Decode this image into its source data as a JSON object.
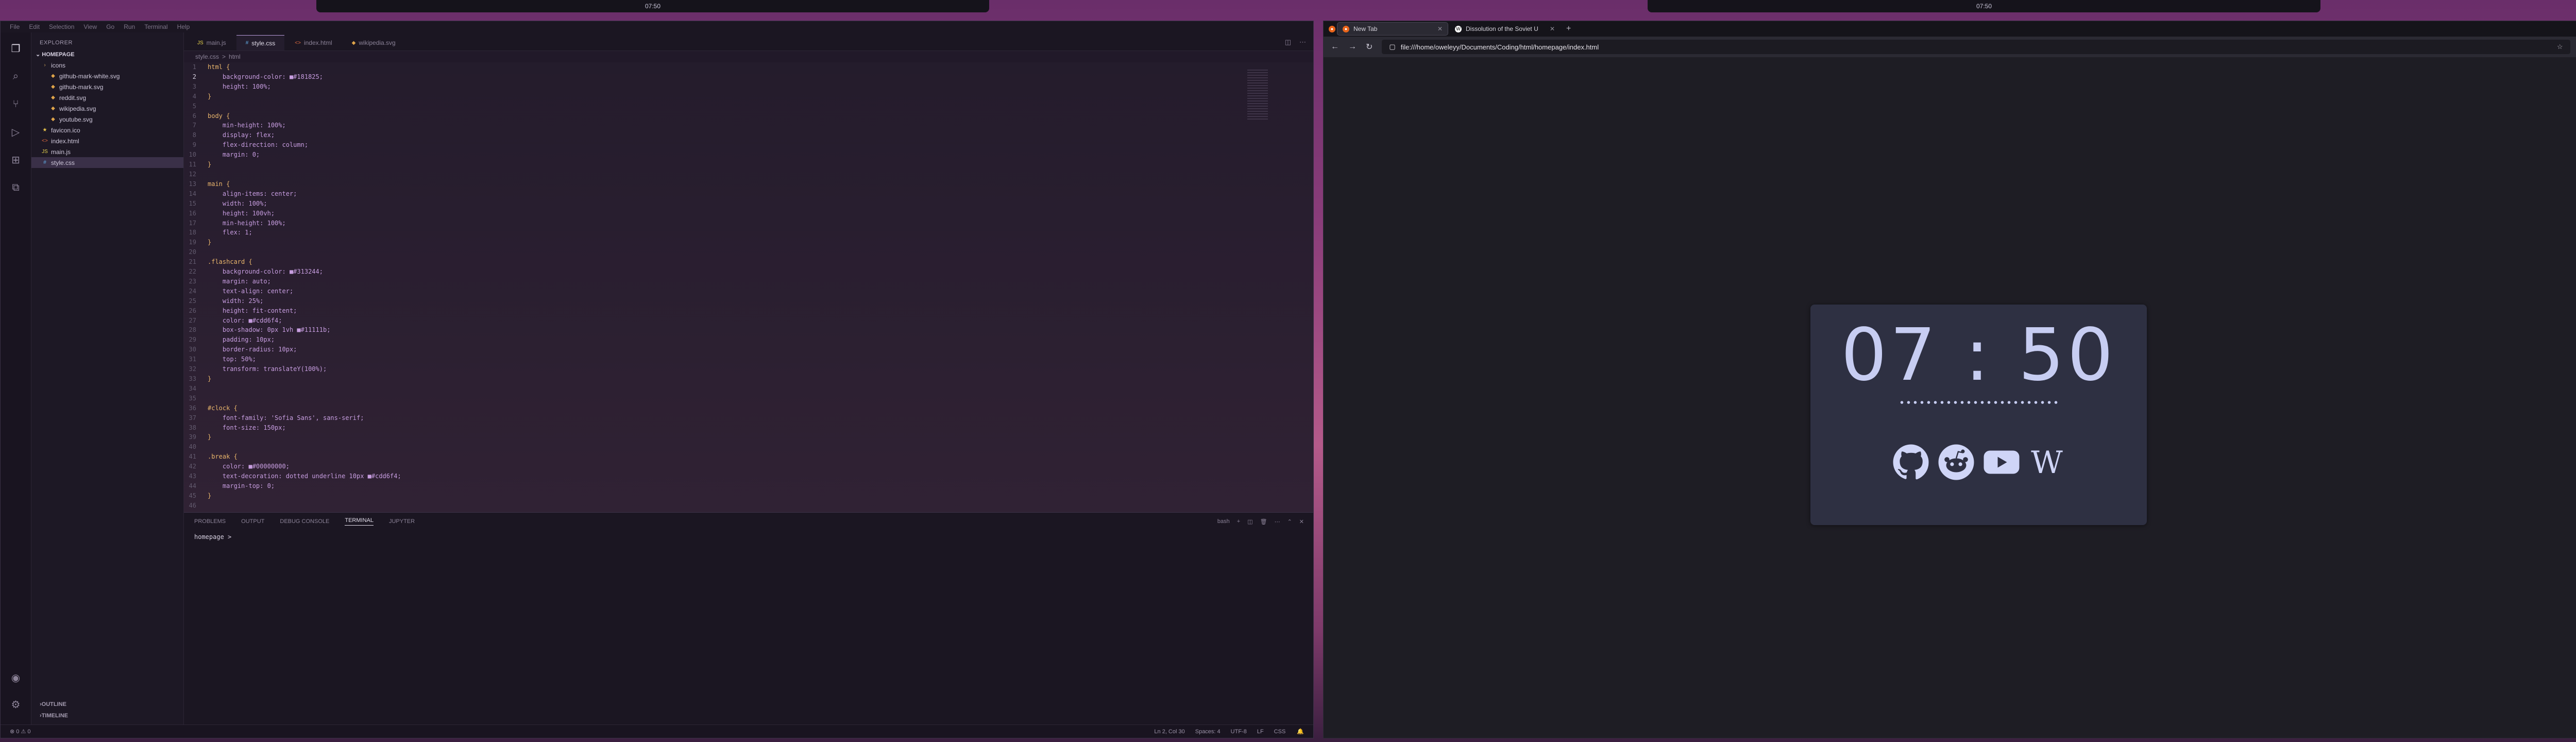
{
  "desktop": {
    "clock_left": "07:50",
    "clock_right": "07:50",
    "workspace_icon": "♾"
  },
  "vscode": {
    "menu": [
      "File",
      "Edit",
      "Selection",
      "View",
      "Go",
      "Run",
      "Terminal",
      "Help"
    ],
    "explorer_label": "EXPLORER",
    "folder": "HOMEPAGE",
    "tree": [
      {
        "name": "icons",
        "depth": 1,
        "kind": "folder"
      },
      {
        "name": "github-mark-white.svg",
        "depth": 2,
        "kind": "svg"
      },
      {
        "name": "github-mark.svg",
        "depth": 2,
        "kind": "svg"
      },
      {
        "name": "reddit.svg",
        "depth": 2,
        "kind": "svg"
      },
      {
        "name": "wikipedia.svg",
        "depth": 2,
        "kind": "svg"
      },
      {
        "name": "youtube.svg",
        "depth": 2,
        "kind": "svg"
      },
      {
        "name": "favicon.ico",
        "depth": 1,
        "kind": "ico"
      },
      {
        "name": "index.html",
        "depth": 1,
        "kind": "html"
      },
      {
        "name": "main.js",
        "depth": 1,
        "kind": "js"
      },
      {
        "name": "style.css",
        "depth": 1,
        "kind": "css",
        "selected": true
      }
    ],
    "outline": "OUTLINE",
    "timeline": "TIMELINE",
    "tabs": [
      {
        "label": "main.js",
        "active": false
      },
      {
        "label": "style.css",
        "active": true
      },
      {
        "label": "index.html",
        "active": false
      },
      {
        "label": "wikipedia.svg",
        "active": false
      }
    ],
    "breadcrumb": [
      "style.css",
      ">",
      "html"
    ],
    "code": [
      {
        "n": "1",
        "t": "html {"
      },
      {
        "n": "2",
        "t": "    background-color: ■#181825;"
      },
      {
        "n": "3",
        "t": "    height: 100%;"
      },
      {
        "n": "4",
        "t": "}"
      },
      {
        "n": "5",
        "t": ""
      },
      {
        "n": "6",
        "t": "body {"
      },
      {
        "n": "7",
        "t": "    min-height: 100%;"
      },
      {
        "n": "8",
        "t": "    display: flex;"
      },
      {
        "n": "9",
        "t": "    flex-direction: column;"
      },
      {
        "n": "10",
        "t": "    margin: 0;"
      },
      {
        "n": "11",
        "t": "}"
      },
      {
        "n": "12",
        "t": ""
      },
      {
        "n": "13",
        "t": "main {"
      },
      {
        "n": "14",
        "t": "    align-items: center;"
      },
      {
        "n": "15",
        "t": "    width: 100%;"
      },
      {
        "n": "16",
        "t": "    height: 100vh;"
      },
      {
        "n": "17",
        "t": "    min-height: 100%;"
      },
      {
        "n": "18",
        "t": "    flex: 1;"
      },
      {
        "n": "19",
        "t": "}"
      },
      {
        "n": "20",
        "t": ""
      },
      {
        "n": "21",
        "t": ".flashcard {"
      },
      {
        "n": "22",
        "t": "    background-color: ■#313244;"
      },
      {
        "n": "23",
        "t": "    margin: auto;"
      },
      {
        "n": "24",
        "t": "    text-align: center;"
      },
      {
        "n": "25",
        "t": "    width: 25%;"
      },
      {
        "n": "26",
        "t": "    height: fit-content;"
      },
      {
        "n": "27",
        "t": "    color: ■#cdd6f4;"
      },
      {
        "n": "28",
        "t": "    box-shadow: 0px 1vh ■#11111b;"
      },
      {
        "n": "29",
        "t": "    padding: 10px;"
      },
      {
        "n": "30",
        "t": "    border-radius: 10px;"
      },
      {
        "n": "31",
        "t": "    top: 50%;"
      },
      {
        "n": "32",
        "t": "    transform: translateY(100%);"
      },
      {
        "n": "33",
        "t": "}"
      },
      {
        "n": "34",
        "t": ""
      },
      {
        "n": "35",
        "t": ""
      },
      {
        "n": "36",
        "t": "#clock {"
      },
      {
        "n": "37",
        "t": "    font-family: 'Sofia Sans', sans-serif;"
      },
      {
        "n": "38",
        "t": "    font-size: 150px;"
      },
      {
        "n": "39",
        "t": "}"
      },
      {
        "n": "40",
        "t": ""
      },
      {
        "n": "41",
        "t": ".break {"
      },
      {
        "n": "42",
        "t": "    color: ■#00000000;"
      },
      {
        "n": "43",
        "t": "    text-decoration: dotted underline 10px ■#cdd6f4;"
      },
      {
        "n": "44",
        "t": "    margin-top: 0;"
      },
      {
        "n": "45",
        "t": "}"
      },
      {
        "n": "46",
        "t": ""
      }
    ],
    "panel_tabs": [
      "PROBLEMS",
      "OUTPUT",
      "DEBUG CONSOLE",
      "TERMINAL",
      "JUPYTER"
    ],
    "panel_active": "TERMINAL",
    "terminal_shell": "bash",
    "terminal_prompt": "homepage >",
    "status_left": "⊗ 0 ⚠ 0",
    "status_right": [
      "Ln 2, Col 30",
      "Spaces: 4",
      "UTF-8",
      "LF",
      "CSS"
    ]
  },
  "browser": {
    "tabs": [
      {
        "label": "New Tab",
        "active": true
      },
      {
        "label": "Dissolution of the Soviet U",
        "active": false
      }
    ],
    "url": "file:///home/oweleyy/Documents/Coding/html/homepage/index.html",
    "page": {
      "clock": "07 : 50",
      "links": [
        "github",
        "reddit",
        "youtube",
        "wikipedia"
      ]
    }
  },
  "colors": {
    "card": "#2e3042",
    "text": "#cdd6f4",
    "page_bg": "#181825"
  }
}
